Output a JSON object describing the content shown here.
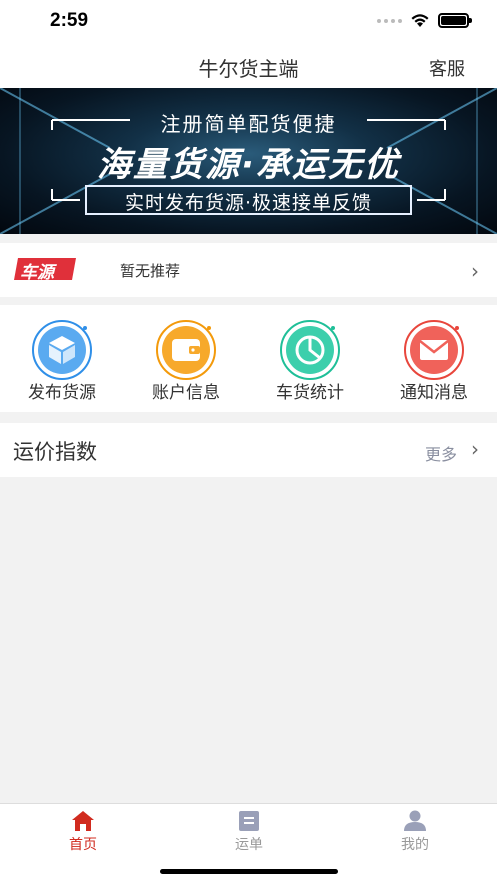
{
  "status": {
    "time": "2:59"
  },
  "header": {
    "title": "牛尔货主端",
    "service": "客服"
  },
  "banner": {
    "line1": "注册简单配货便捷",
    "line2": "海量货源·承运无优",
    "line3": "实时发布货源·极速接单反馈"
  },
  "car_source": {
    "badge": "车源",
    "text": "暂无推荐",
    "arrow": "›"
  },
  "quick_menu": [
    {
      "label": "发布货源",
      "icon": "cube-icon",
      "color": "#2f8fe8"
    },
    {
      "label": "账户信息",
      "icon": "wallet-icon",
      "color": "#f39a0b"
    },
    {
      "label": "车货统计",
      "icon": "pie-chart-icon",
      "color": "#1fbf98"
    },
    {
      "label": "通知消息",
      "icon": "mail-icon",
      "color": "#e8463c"
    }
  ],
  "freight_index": {
    "title": "运价指数",
    "more": "更多",
    "arrow": "›"
  },
  "tabs": [
    {
      "label": "首页",
      "icon": "home-icon",
      "active": true
    },
    {
      "label": "运单",
      "icon": "waybill-icon",
      "active": false
    },
    {
      "label": "我的",
      "icon": "user-icon",
      "active": false
    }
  ],
  "colors": {
    "accent": "#d12b1f",
    "badge_red": "#e0303a"
  }
}
